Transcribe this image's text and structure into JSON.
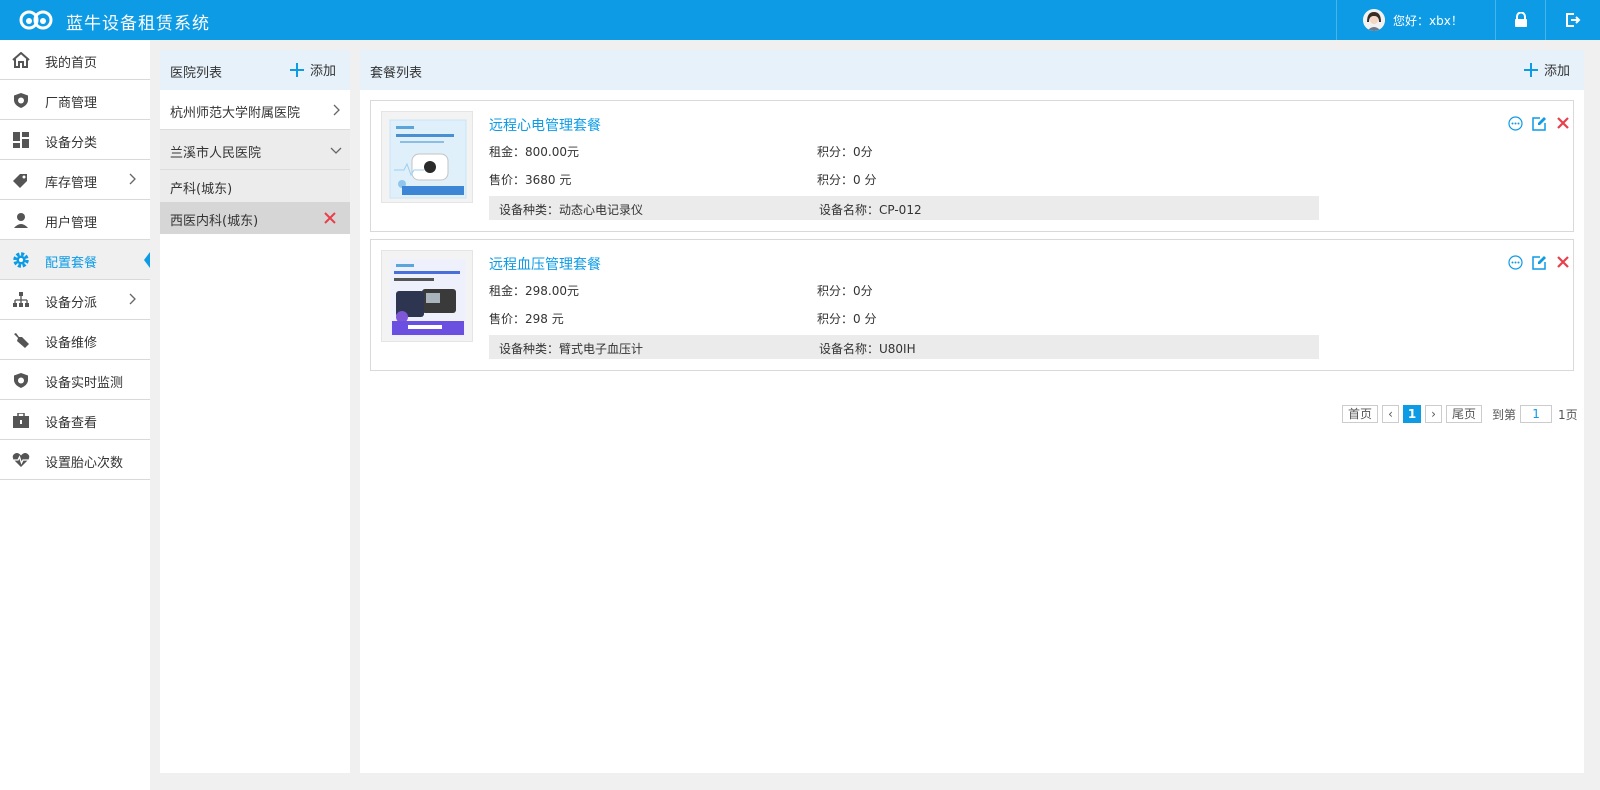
{
  "header": {
    "app_title": "蓝牛设备租赁系统",
    "greeting": "您好：xbx！"
  },
  "sidebar": {
    "items": [
      {
        "label": "我的首页",
        "icon": "home-icon"
      },
      {
        "label": "厂商管理",
        "icon": "shield-icon"
      },
      {
        "label": "设备分类",
        "icon": "grid-icon"
      },
      {
        "label": "库存管理",
        "icon": "tag-icon"
      },
      {
        "label": "用户管理",
        "icon": "user-icon"
      },
      {
        "label": "配置套餐",
        "icon": "gear-icon"
      },
      {
        "label": "设备分派",
        "icon": "org-chart-icon"
      },
      {
        "label": "设备维修",
        "icon": "wrench-icon"
      },
      {
        "label": "设备实时监测",
        "icon": "monitor-shield-icon"
      },
      {
        "label": "设备查看",
        "icon": "toolbox-icon"
      },
      {
        "label": "设置胎心次数",
        "icon": "heartbeat-icon"
      }
    ]
  },
  "hospitals": {
    "title": "医院列表",
    "add_label": "添加",
    "items": [
      {
        "name": "杭州师范大学附属医院"
      },
      {
        "name": "兰溪市人民医院",
        "departments": [
          "产科(城东)",
          "西医内科(城东)"
        ]
      }
    ]
  },
  "packages": {
    "title": "套餐列表",
    "add_label": "添加",
    "items": [
      {
        "name": "远程心电管理套餐",
        "rent": "租金：800.00元",
        "rent_points": "积分：0分",
        "price": "售价：3680 元",
        "price_points": "积分：0 分",
        "device_type": "设备种类：动态心电记录仪",
        "device_name": "设备名称：CP-012"
      },
      {
        "name": "远程血压管理套餐",
        "rent": "租金：298.00元",
        "rent_points": "积分：0分",
        "price": "售价：298 元",
        "price_points": "积分：0 分",
        "device_type": "设备种类：臂式电子血压计",
        "device_name": "设备名称：U80IH"
      }
    ]
  },
  "pagination": {
    "first": "首页",
    "prev": "‹",
    "current": "1",
    "next": "›",
    "last": "尾页",
    "goto_label": "到第",
    "page_input": "1",
    "total": "1页"
  },
  "colors": {
    "primary": "#0d9be6",
    "danger": "#e8404b"
  }
}
